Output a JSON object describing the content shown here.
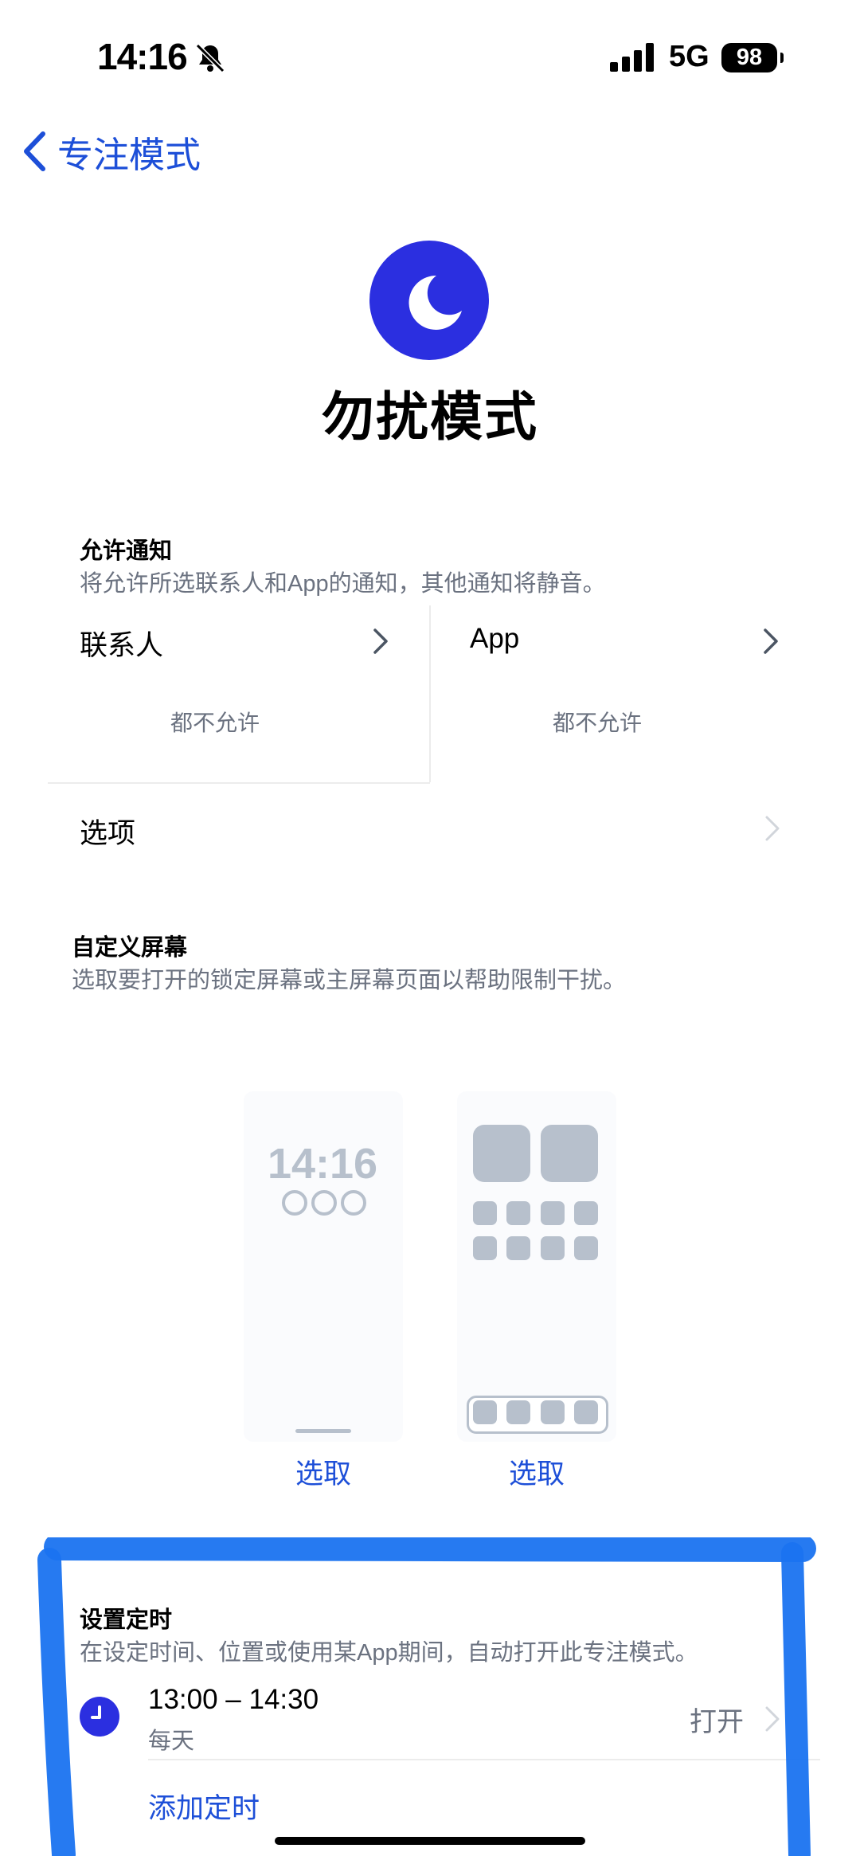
{
  "status_bar": {
    "time": "14:16",
    "network": "5G",
    "battery": "98"
  },
  "nav": {
    "back_label": "专注模式"
  },
  "header": {
    "title": "勿扰模式",
    "icon": "moon-icon"
  },
  "allow_notifications": {
    "heading": "允许通知",
    "subtitle": "将允许所选联系人和App的通知，其他通知将静音。",
    "contacts": {
      "label": "联系人",
      "value": "都不允许"
    },
    "apps": {
      "label": "App",
      "value": "都不允许"
    },
    "options_label": "选项"
  },
  "customize_screens": {
    "heading": "自定义屏幕",
    "subtitle": "选取要打开的锁定屏幕或主屏幕页面以帮助限制干扰。",
    "lock_preview_time": "14:16",
    "lock_select": "选取",
    "home_select": "选取"
  },
  "schedule": {
    "heading": "设置定时",
    "subtitle": "在设定时间、位置或使用某App期间，自动打开此专注模式。",
    "items": [
      {
        "time": "13:00 – 14:30",
        "days": "每天",
        "status": "打开"
      }
    ],
    "add_label": "添加定时"
  },
  "colors": {
    "accent": "#1d4fd8",
    "focus_purple": "#2b2fe0",
    "annotation": "#1a73f0"
  }
}
